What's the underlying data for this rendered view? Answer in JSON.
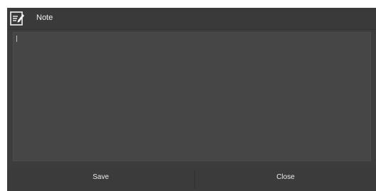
{
  "window": {
    "title": "Note",
    "icon": "note-edit-icon"
  },
  "editor": {
    "value": "",
    "placeholder": ""
  },
  "buttons": {
    "save_label": "Save",
    "close_label": "Close"
  },
  "colors": {
    "background": "#3b3b3b",
    "editor_background": "#464646",
    "text": "#e9e9e9"
  }
}
